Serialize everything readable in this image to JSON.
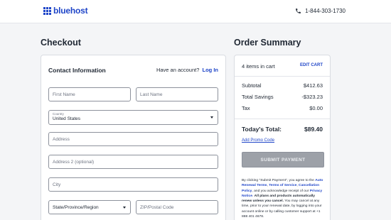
{
  "header": {
    "logo_text": "bluehost",
    "phone_icon": "phone-icon",
    "phone": "1-844-303-1730",
    "brand_color": "#1f45c8"
  },
  "checkout": {
    "title": "Checkout",
    "contact_title": "Contact Information",
    "account_prompt": "Have an account?",
    "login_label": "Log In",
    "fields": {
      "first_name": "First Name",
      "last_name": "Last Name",
      "country_label": "Country",
      "country_value": "United States",
      "address": "Address",
      "address2": "Address 2 (optional)",
      "city": "City",
      "state": "State/Province/Region",
      "zip": "ZIP/Postal Code"
    }
  },
  "summary": {
    "title": "Order Summary",
    "items_in_cart": "4 items in cart",
    "edit_cart": "EDIT CART",
    "subtotal_label": "Subtotal",
    "subtotal_value": "$412.63",
    "savings_label": "Total Savings",
    "savings_value": "-$323.23",
    "tax_label": "Tax",
    "tax_value": "$0.00",
    "total_label": "Today's Total:",
    "total_value": "$89.40",
    "promo_link": "Add Promo Code",
    "submit_label": "SUBMIT PAYMENT",
    "legal": {
      "p1": "By clicking \"Submit Payment\", you agree to the",
      "link_auto": "Auto Renewal Terms",
      "comma1": ",",
      "link_tos": "Terms of Service",
      "comma2": ",",
      "link_cancel": "Cancellation Policy",
      "p2": ", and you acknowledge receipt of our",
      "link_privacy": "Privacy Notice",
      "p3": ".",
      "bold": "All plans and products automatically renew unless you cancel.",
      "p4": "You may cancel at any time, prior to your renewal date, by logging into your account online or by calling customer support at +1 888 401 4678."
    }
  }
}
